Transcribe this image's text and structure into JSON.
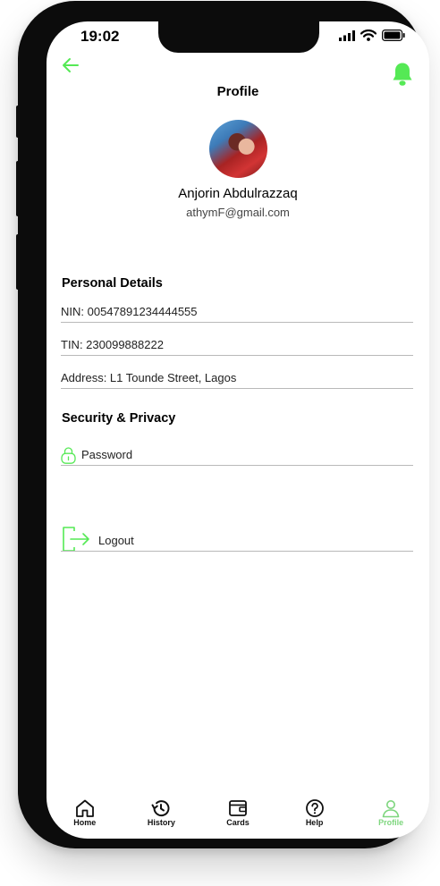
{
  "status_bar": {
    "time": "19:02"
  },
  "header": {
    "title": "Profile"
  },
  "user": {
    "name": "Anjorin Abdulrazzaq",
    "email": "athymF@gmail.com"
  },
  "personal_details": {
    "title": "Personal Details",
    "nin": "NIN: 00547891234444555",
    "tin": "TIN: 230099888222",
    "address": "Address: L1 Tounde Street, Lagos"
  },
  "security": {
    "title": "Security & Privacy",
    "password_label": "Password"
  },
  "logout_label": "Logout",
  "tabs": [
    {
      "label": "Home",
      "icon": "home-icon"
    },
    {
      "label": "History",
      "icon": "history-icon"
    },
    {
      "label": "Cards",
      "icon": "wallet-icon"
    },
    {
      "label": "Help",
      "icon": "help-icon"
    },
    {
      "label": "Profile",
      "icon": "user-icon",
      "active": true
    }
  ],
  "colors": {
    "accent": "#55e955",
    "active_tab": "#7ed67e",
    "divider": "#b9b9b9"
  }
}
